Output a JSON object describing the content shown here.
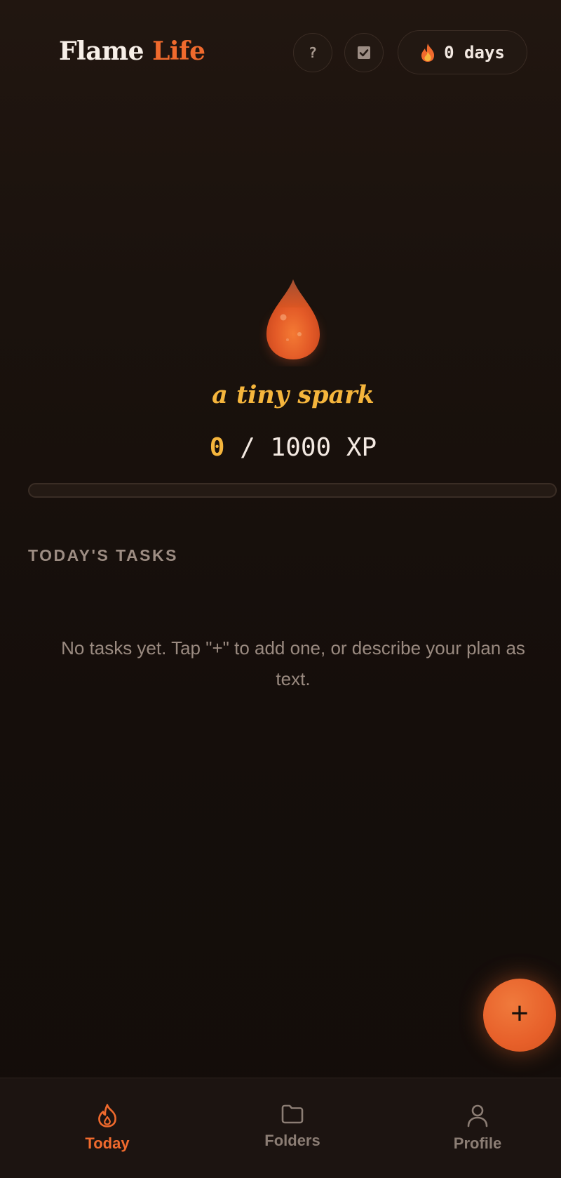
{
  "header": {
    "brand_first": "Flame",
    "brand_second": "Life",
    "help_label": "?",
    "streak_text": "0 days"
  },
  "hero": {
    "level_name": "a tiny spark",
    "xp_current": "0",
    "xp_separator": "/",
    "xp_total": "1000 XP",
    "progress_fraction": 0
  },
  "tasks": {
    "title": "TODAY'S TASKS",
    "empty_message": "No tasks yet. Tap \"+\" to add one, or describe your plan as text."
  },
  "fab": {
    "label": "+"
  },
  "nav": {
    "items": [
      {
        "label": "Today",
        "icon": "flame-icon",
        "active": true
      },
      {
        "label": "Folders",
        "icon": "folder-icon",
        "active": false
      },
      {
        "label": "Profile",
        "icon": "user-icon",
        "active": false
      }
    ]
  },
  "colors": {
    "accent": "#f06a2d",
    "gold": "#f5b53c",
    "background": "#150e0b",
    "muted": "#9a8a80"
  }
}
